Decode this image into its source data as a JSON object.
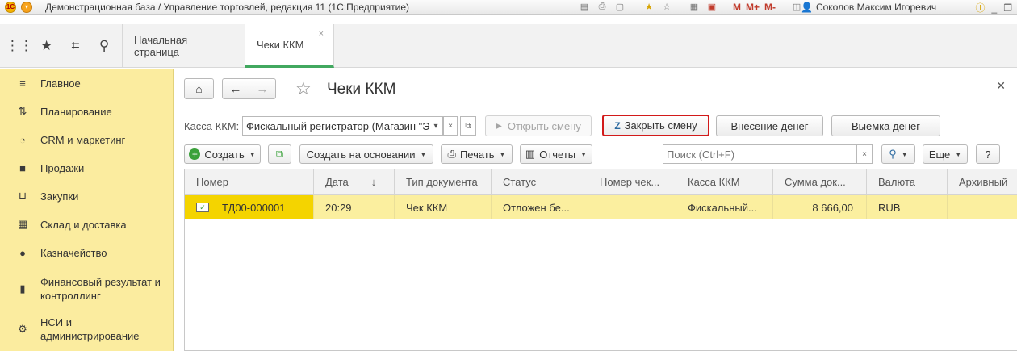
{
  "titlebar": {
    "title": "Демонстрационная база / Управление торговлей, редакция 11  (1С:Предприятие)",
    "m_buttons": [
      "M",
      "M+",
      "M-"
    ],
    "user": "Соколов Максим Игоревич"
  },
  "tabs": [
    {
      "label": "Начальная страница"
    },
    {
      "label": "Чеки ККМ",
      "active": true,
      "close": "×"
    }
  ],
  "sidebar": {
    "items": [
      {
        "label": "Главное",
        "icon": "menu-icon"
      },
      {
        "label": "Планирование",
        "icon": "planning-icon"
      },
      {
        "label": "CRM и маркетинг",
        "icon": "pie-chart-icon"
      },
      {
        "label": "Продажи",
        "icon": "bag-icon"
      },
      {
        "label": "Закупки",
        "icon": "cart-icon"
      },
      {
        "label": "Склад и доставка",
        "icon": "warehouse-icon"
      },
      {
        "label": "Казначейство",
        "icon": "coin-icon"
      },
      {
        "label": "Финансовый результат и контроллинг",
        "icon": "bar-chart-icon"
      },
      {
        "label": "НСИ и администрирование",
        "icon": "gear-icon"
      }
    ]
  },
  "page": {
    "title": "Чеки ККМ",
    "kassa_label": "Касса ККМ:",
    "kassa_value": "Фискальный регистратор (Магазин \"Э",
    "open_shift": "Открыть смену",
    "close_shift": "Закрыть смену",
    "cash_in": "Внесение денег",
    "cash_out": "Выемка денег",
    "create": "Создать",
    "create_based": "Создать на основании",
    "print": "Печать",
    "reports": "Отчеты",
    "search_placeholder": "Поиск (Ctrl+F)",
    "more": "Еще",
    "help": "?"
  },
  "table": {
    "columns": [
      "Номер",
      "Дата",
      "Тип документа",
      "Статус",
      "Номер чек...",
      "Касса ККМ",
      "Сумма док...",
      "Валюта",
      "Архивный"
    ],
    "sort_indicator": "↓",
    "rows": [
      {
        "number": "ТД00-000001",
        "date": "20:29",
        "type": "Чек ККМ",
        "status": "Отложен бе...",
        "check_no": "",
        "kassa": "Фискальный...",
        "sum": "8 666,00",
        "currency": "RUB",
        "archive": ""
      }
    ]
  },
  "colors": {
    "sidebar_bg": "#fbec9f",
    "row_highlight": "#fbef9f",
    "selected_cell": "#f4d400",
    "active_tab_underline": "#41a85f",
    "highlight_border": "#d21a1a"
  }
}
